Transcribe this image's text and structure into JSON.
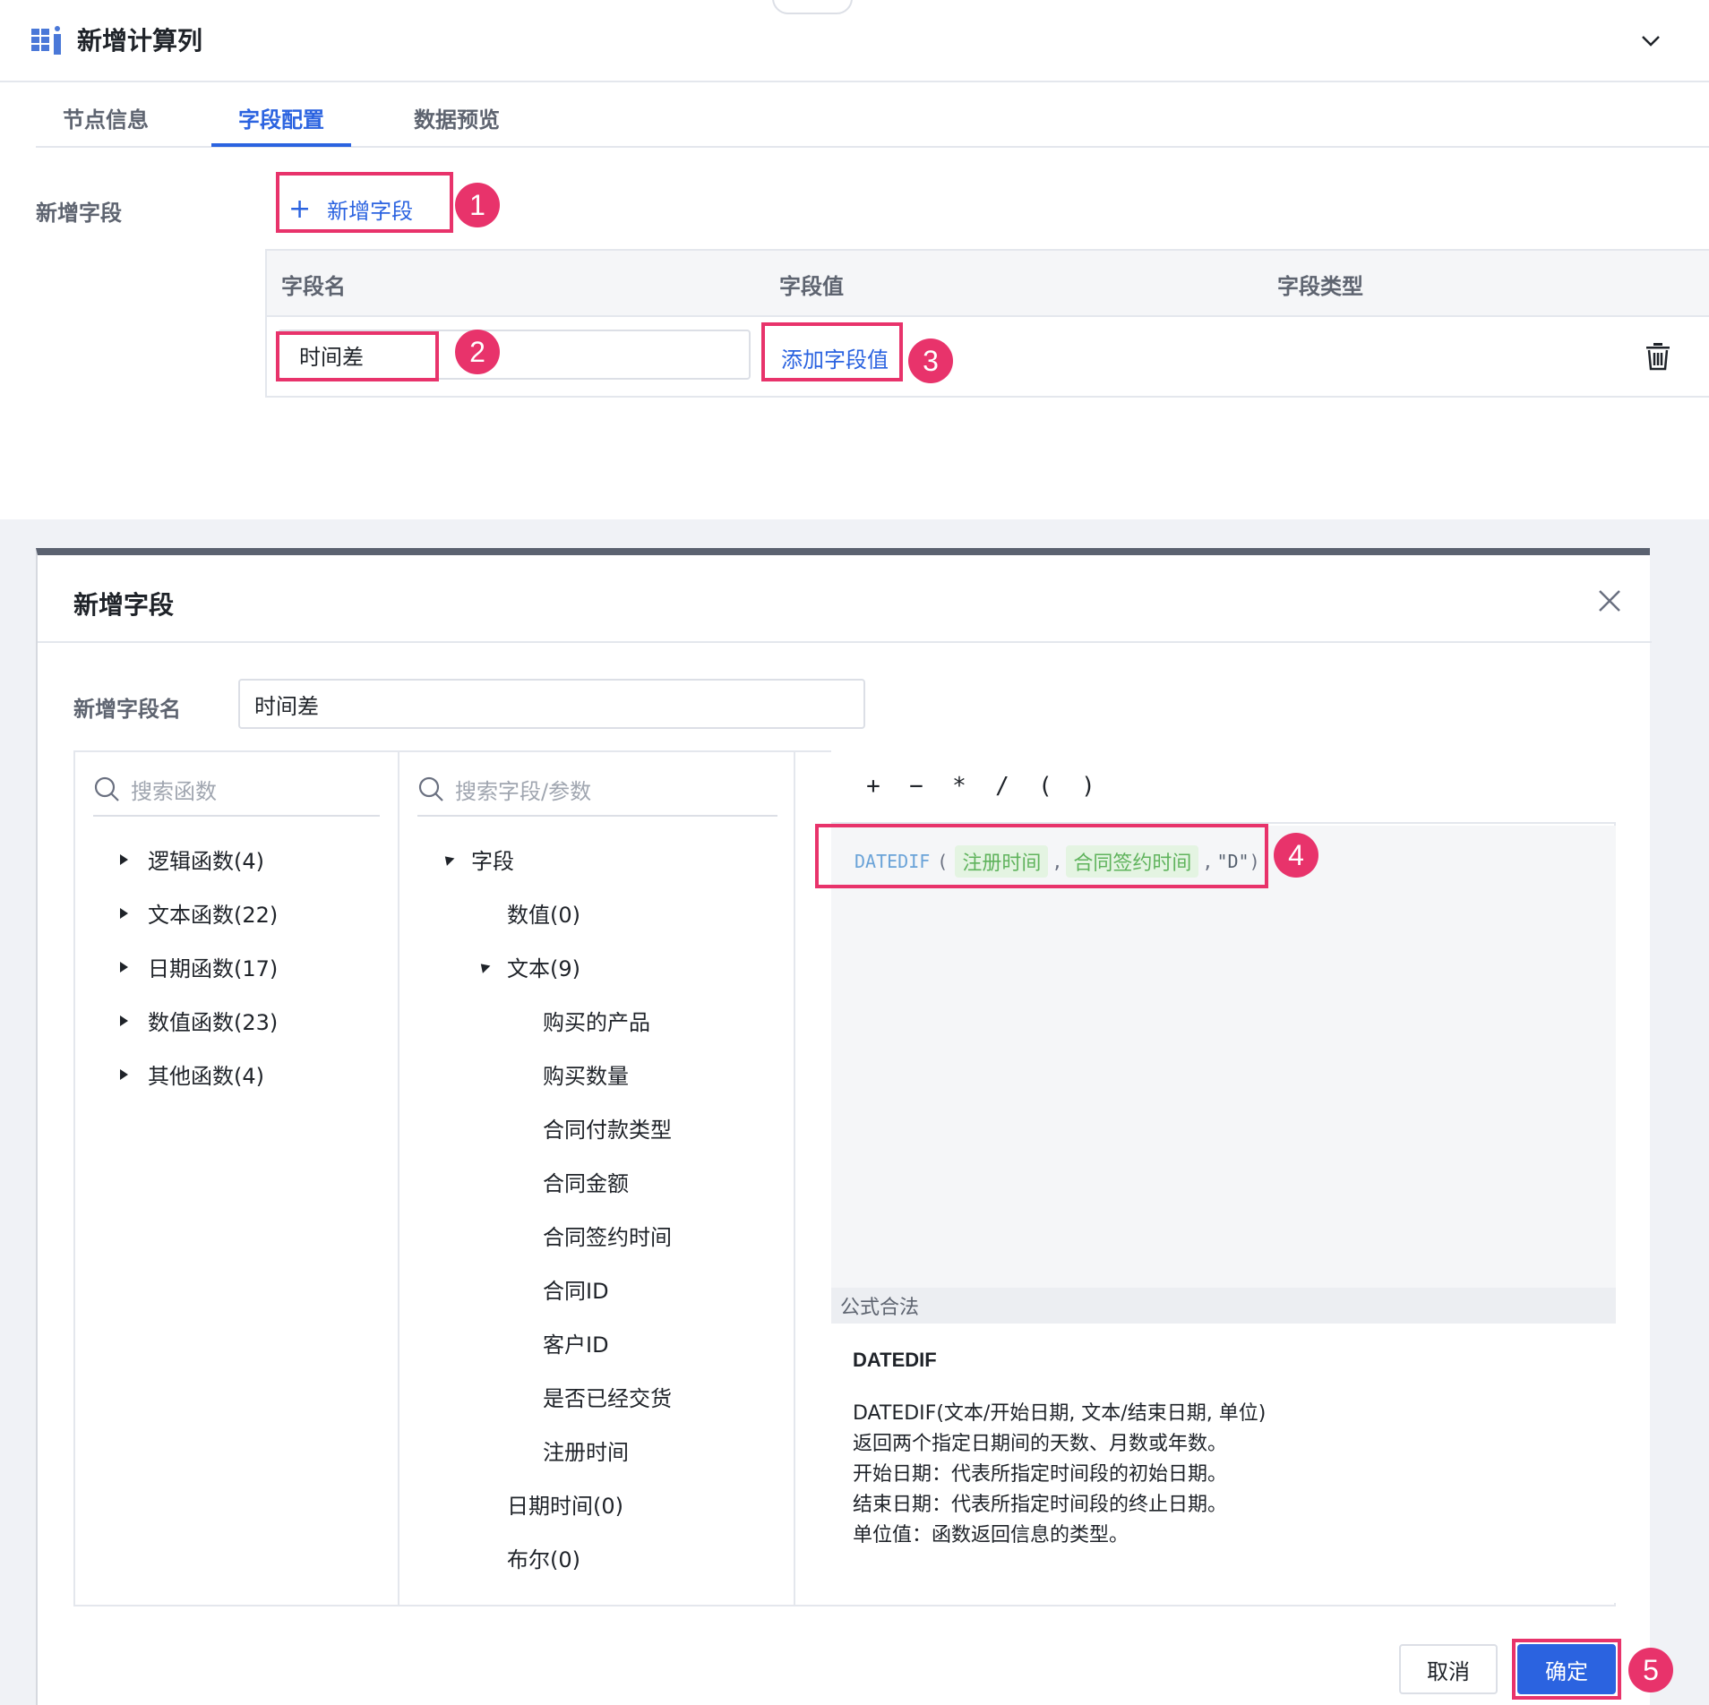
{
  "node": {
    "title": "新增计算列",
    "icon": "table-columns-icon",
    "collapse_icon": "chevron-down-icon"
  },
  "tabs": [
    {
      "label": "节点信息",
      "active": false
    },
    {
      "label": "字段配置",
      "active": true
    },
    {
      "label": "数据预览",
      "active": false
    }
  ],
  "field_config": {
    "add_label": "新增字段",
    "add_button": "新增字段",
    "columns": [
      "字段名",
      "字段值",
      "字段类型"
    ],
    "row": {
      "name_value": "时间差",
      "add_value_link": "添加字段值",
      "delete_icon": "trash-icon"
    }
  },
  "badges": [
    "1",
    "2",
    "3",
    "4",
    "5"
  ],
  "dialog": {
    "title": "新增字段",
    "name_label": "新增字段名",
    "name_value": "时间差",
    "function_search_placeholder": "搜索函数",
    "functions": [
      "逻辑函数(4)",
      "文本函数(22)",
      "日期函数(17)",
      "数值函数(23)",
      "其他函数(4)"
    ],
    "field_search_placeholder": "搜索字段/参数",
    "fields_root": "字段",
    "field_groups": {
      "numeric": "数值(0)",
      "text": "文本(9)",
      "text_items": [
        "购买的产品",
        "购买数量",
        "合同付款类型",
        "合同金额",
        "合同签约时间",
        "合同ID",
        "客户ID",
        "是否已经交货",
        "注册时间"
      ],
      "datetime": "日期时间(0)",
      "boolean": "布尔(0)"
    },
    "operators": [
      "+",
      "−",
      "*",
      "/",
      "(",
      ")"
    ],
    "formula": {
      "function": "DATEDIF",
      "open": "(",
      "arg1": "注册时间",
      "comma1": ",",
      "arg2": "合同签约时间",
      "comma2": ",",
      "arg3": "\"D\"",
      "close": ")"
    },
    "status": "公式合法",
    "help": {
      "title": "DATEDIF",
      "lines": [
        "DATEDIF(文本/开始日期, 文本/结束日期, 单位)",
        "返回两个指定日期间的天数、月数或年数。",
        "开始日期：代表所指定时间段的初始日期。",
        "结束日期：代表所指定时间段的终止日期。",
        "单位值：函数返回信息的类型。"
      ]
    },
    "cancel": "取消",
    "confirm": "确定"
  },
  "colors": {
    "accent": "#2b63e0",
    "highlight": "#e8336b",
    "token_bg": "#e4f4e2",
    "token_text": "#5fb35c"
  }
}
